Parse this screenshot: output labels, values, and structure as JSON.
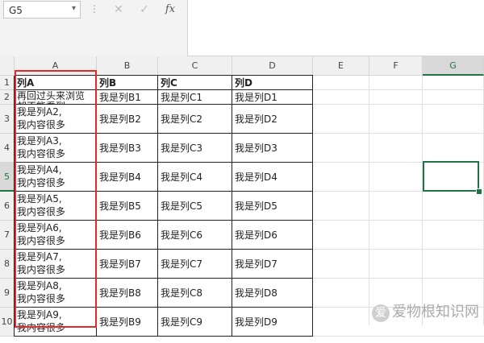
{
  "formula_bar": {
    "name_box": "G5",
    "cancel_icon": "close-icon",
    "confirm_icon": "check-icon",
    "fx_label": "fx",
    "formula": ""
  },
  "grid": {
    "columns": [
      "A",
      "B",
      "C",
      "D",
      "E",
      "F",
      "G"
    ],
    "selected_column": "G",
    "selected_row": "5",
    "rows": [
      {
        "num": "1",
        "a": "列A",
        "b": "列B",
        "c": "列C",
        "d": "列D",
        "bold": true
      },
      {
        "num": "2",
        "a": "再回过头来浏览却不能看到",
        "b": "我是列B1",
        "c": "我是列C1",
        "d": "我是列D1",
        "bold": false
      },
      {
        "num": "3",
        "a": "我是列A2,\n我内容很多",
        "b": "我是列B2",
        "c": "我是列C2",
        "d": "我是列D2",
        "bold": false
      },
      {
        "num": "4",
        "a": "我是列A3,\n我内容很多",
        "b": "我是列B3",
        "c": "我是列C3",
        "d": "我是列D3",
        "bold": false
      },
      {
        "num": "5",
        "a": "我是列A4,\n我内容很多",
        "b": "我是列B4",
        "c": "我是列C4",
        "d": "我是列D4",
        "bold": false
      },
      {
        "num": "6",
        "a": "我是列A5,\n我内容很多",
        "b": "我是列B5",
        "c": "我是列C5",
        "d": "我是列D5",
        "bold": false
      },
      {
        "num": "7",
        "a": "我是列A6,\n我内容很多",
        "b": "我是列B6",
        "c": "我是列C6",
        "d": "我是列D6",
        "bold": false
      },
      {
        "num": "8",
        "a": "我是列A7,\n我内容很多",
        "b": "我是列B7",
        "c": "我是列C7",
        "d": "我是列D7",
        "bold": false
      },
      {
        "num": "9",
        "a": "我是列A8,\n我内容很多",
        "b": "我是列B8",
        "c": "我是列C8",
        "d": "我是列D8",
        "bold": false
      },
      {
        "num": "10",
        "a": "我是列A9,\n我内容很多",
        "b": "我是列B9",
        "c": "我是列C9",
        "d": "我是列D9",
        "bold": false
      }
    ]
  },
  "watermark": {
    "badge": "爱",
    "text": "爱物根知识网"
  },
  "colors": {
    "accent": "#217346",
    "highlight": "#e62828"
  }
}
